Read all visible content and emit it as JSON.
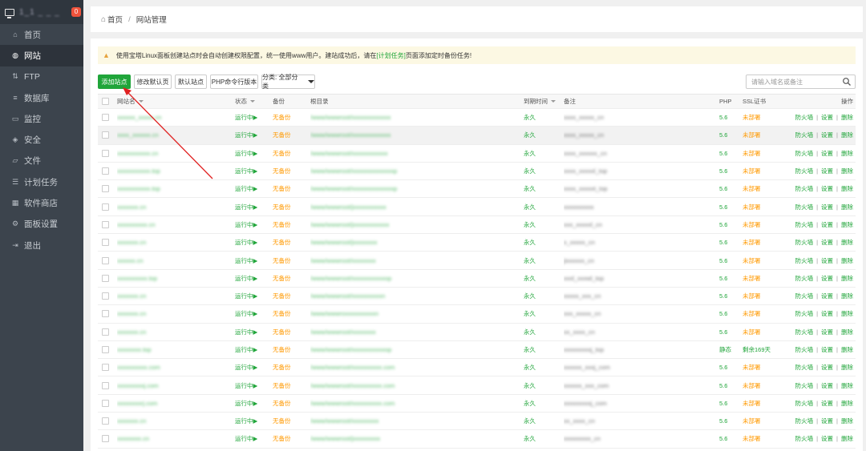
{
  "sidebar": {
    "server_name": "1_1 _ _ _",
    "badge": "0",
    "items": [
      {
        "label": "首页",
        "icon": "home-icon"
      },
      {
        "label": "网站",
        "icon": "globe-icon",
        "active": true
      },
      {
        "label": "FTP",
        "icon": "ftp-icon"
      },
      {
        "label": "数据库",
        "icon": "database-icon"
      },
      {
        "label": "监控",
        "icon": "monitor-icon"
      },
      {
        "label": "安全",
        "icon": "shield-icon"
      },
      {
        "label": "文件",
        "icon": "folder-icon"
      },
      {
        "label": "计划任务",
        "icon": "list-icon"
      },
      {
        "label": "软件商店",
        "icon": "grid-icon"
      },
      {
        "label": "面板设置",
        "icon": "gear-icon"
      },
      {
        "label": "退出",
        "icon": "logout-icon"
      }
    ]
  },
  "breadcrumb": {
    "home": "首页",
    "sep": "/",
    "current": "网站管理"
  },
  "notice": {
    "before": "使用宝塔Linux面板创建站点时会自动创建权限配置，统一使用www用户。建站成功后，请在",
    "link": "[计划任务]",
    "after": "页面添加定时备份任务!"
  },
  "toolbar": {
    "add": "添加站点",
    "default_page": "修改默认页",
    "default_site": "默认站点",
    "php_cli": "PHP命令行版本",
    "category": "分类: 全部分类",
    "search_placeholder": "请输入域名或备注"
  },
  "columns": {
    "name": "网站名",
    "status": "状态",
    "backup": "备份",
    "root": "根目录",
    "expire": "到期时间",
    "remark": "备注",
    "php": "PHP",
    "ssl": "SSL证书",
    "ops": "操作"
  },
  "ops": {
    "firewall": "防火墙",
    "settings": "设置",
    "delete": "删除",
    "sep": "|"
  },
  "rows": [
    {
      "name": "xxxxxx_xxxxx.cn",
      "status": "运行中▶",
      "backup": "无备份",
      "path": "/www/wwwroot/xxxxxxxxxxxxx",
      "expire": "永久",
      "remark": "xxxx_xxxxx_cn",
      "php": "5.6",
      "ssl": "未部署"
    },
    {
      "name": "xxxx_xxxxxx.cn",
      "status": "运行中▶",
      "backup": "无备份",
      "path": "/www/wwwroot/xxxxxxxxxxxxx",
      "expire": "永久",
      "remark": "xxxx_xxxxx_cn",
      "php": "5.6",
      "ssl": "未部署",
      "hl": true
    },
    {
      "name": "xxxxxxxxxxx.cn",
      "status": "运行中▶",
      "backup": "无备份",
      "path": "/www/wwwroot/xxxxxxxxxxxx",
      "expire": "永久",
      "remark": "xxxx_xxxxxx_cn",
      "php": "5.6",
      "ssl": "未部署"
    },
    {
      "name": "xxxxxxxxxxx.top",
      "status": "运行中▶",
      "backup": "无备份",
      "path": "/www/wwwroot/xxxxxxxxxxxxxxp",
      "expire": "永久",
      "remark": "xxxx_xxxxxl_top",
      "php": "5.6",
      "ssl": "未部署"
    },
    {
      "name": "xxxxxxxxxxx.top",
      "status": "运行中▶",
      "backup": "无备份",
      "path": "/www/wwwroot/xxxxxxxxxxxxxxp",
      "expire": "永久",
      "remark": "xxxx_xxxxxt_top",
      "php": "5.6",
      "ssl": "未部署"
    },
    {
      "name": "xxxxxxx.cn",
      "status": "运行中▶",
      "backup": "无备份",
      "path": "/www/wwwroot/jxxxxxxxxxxx",
      "expire": "永久",
      "remark": "xxxxxxxxxx",
      "php": "5.6",
      "ssl": "未部署"
    },
    {
      "name": "xxxxxxxxxx.cn",
      "status": "运行中▶",
      "backup": "无备份",
      "path": "/www/wwwroot/jxxxxxxxxxxxx",
      "expire": "永久",
      "remark": "xxx_xxxxxl_cn",
      "php": "5.6",
      "ssl": "未部署"
    },
    {
      "name": "xxxxxxx.cn",
      "status": "运行中▶",
      "backup": "无备份",
      "path": "/www/wwwroot/jxxxxxxxx",
      "expire": "永久",
      "remark": "x_xxxxx_cn",
      "php": "5.6",
      "ssl": "未部署"
    },
    {
      "name": "xxxxxx.cn",
      "status": "运行中▶",
      "backup": "无备份",
      "path": "/www/wwwroot/xxxxxxxx",
      "expire": "永久",
      "remark": "jixxxxxx_cn",
      "php": "5.6",
      "ssl": "未部署"
    },
    {
      "name": "xxxxxxxxxx.top",
      "status": "运行中▶",
      "backup": "无备份",
      "path": "/www/wwwroot/xxxxxxxxxxxop",
      "expire": "永久",
      "remark": "xxxl_xxxwl_top",
      "php": "5.6",
      "ssl": "未部署"
    },
    {
      "name": "xxxxxxx.cn",
      "status": "运行中▶",
      "backup": "无备份",
      "path": "/www/wwwroot/xxxxxxxxxxn",
      "expire": "永久",
      "remark": "xxxxx_xxx_cn",
      "php": "5.6",
      "ssl": "未部署"
    },
    {
      "name": "xxxxxxx.cn",
      "status": "运行中▶",
      "backup": "无备份",
      "path": "/www/wwwroxxxxxxxxxxn",
      "expire": "永久",
      "remark": "xxx_xxxxx_cn",
      "php": "5.6",
      "ssl": "未部署"
    },
    {
      "name": "xxxxxxx.cn",
      "status": "运行中▶",
      "backup": "无备份",
      "path": "/www/wwwroot/xxxxxxxx",
      "expire": "永久",
      "remark": "xx_xxxx_cn",
      "php": "5.6",
      "ssl": "未部署"
    },
    {
      "name": "xxxxxxxx.top",
      "status": "运行中▶",
      "backup": "无备份",
      "path": "/www/wwwroot/xxxxxxxxxxxop",
      "expire": "永久",
      "remark": "xxxxxxxxxj_top",
      "php": "静态",
      "ssl": "剩余169天"
    },
    {
      "name": "xxxxxxxxxx.com",
      "status": "运行中▶",
      "backup": "无备份",
      "path": "/www/wwwroot/xxxxxxxxxx.com",
      "expire": "永久",
      "remark": "xxxxxx_xxxj_com",
      "php": "5.6",
      "ssl": "未部署"
    },
    {
      "name": "xxxxxxxxxj.com",
      "status": "运行中▶",
      "backup": "无备份",
      "path": "/www/wwwroot/xxxxxxxxxx.com",
      "expire": "永久",
      "remark": "xxxxxx_xxx_com",
      "php": "5.6",
      "ssl": "未部署"
    },
    {
      "name": "xxxxxxxxrj.com",
      "status": "运行中▶",
      "backup": "无备份",
      "path": "/www/wwwroot/xxxxxxxxxx.com",
      "expire": "永久",
      "remark": "xxxxxxxxxj_com",
      "php": "5.6",
      "ssl": "未部署"
    },
    {
      "name": "xxxxxxx.cn",
      "status": "运行中▶",
      "backup": "无备份",
      "path": "/www/wwwroot/xxxxxxxxx",
      "expire": "永久",
      "remark": "xx_xxxx_cn",
      "php": "5.6",
      "ssl": "未部署"
    },
    {
      "name": "xxxxxxxx.cn",
      "status": "运行中▶",
      "backup": "无备份",
      "path": "/www/wwwroot/jxxxxxxxxx",
      "expire": "永久",
      "remark": "xxxxxxxxx_cn",
      "php": "5.6",
      "ssl": "未部署"
    }
  ]
}
